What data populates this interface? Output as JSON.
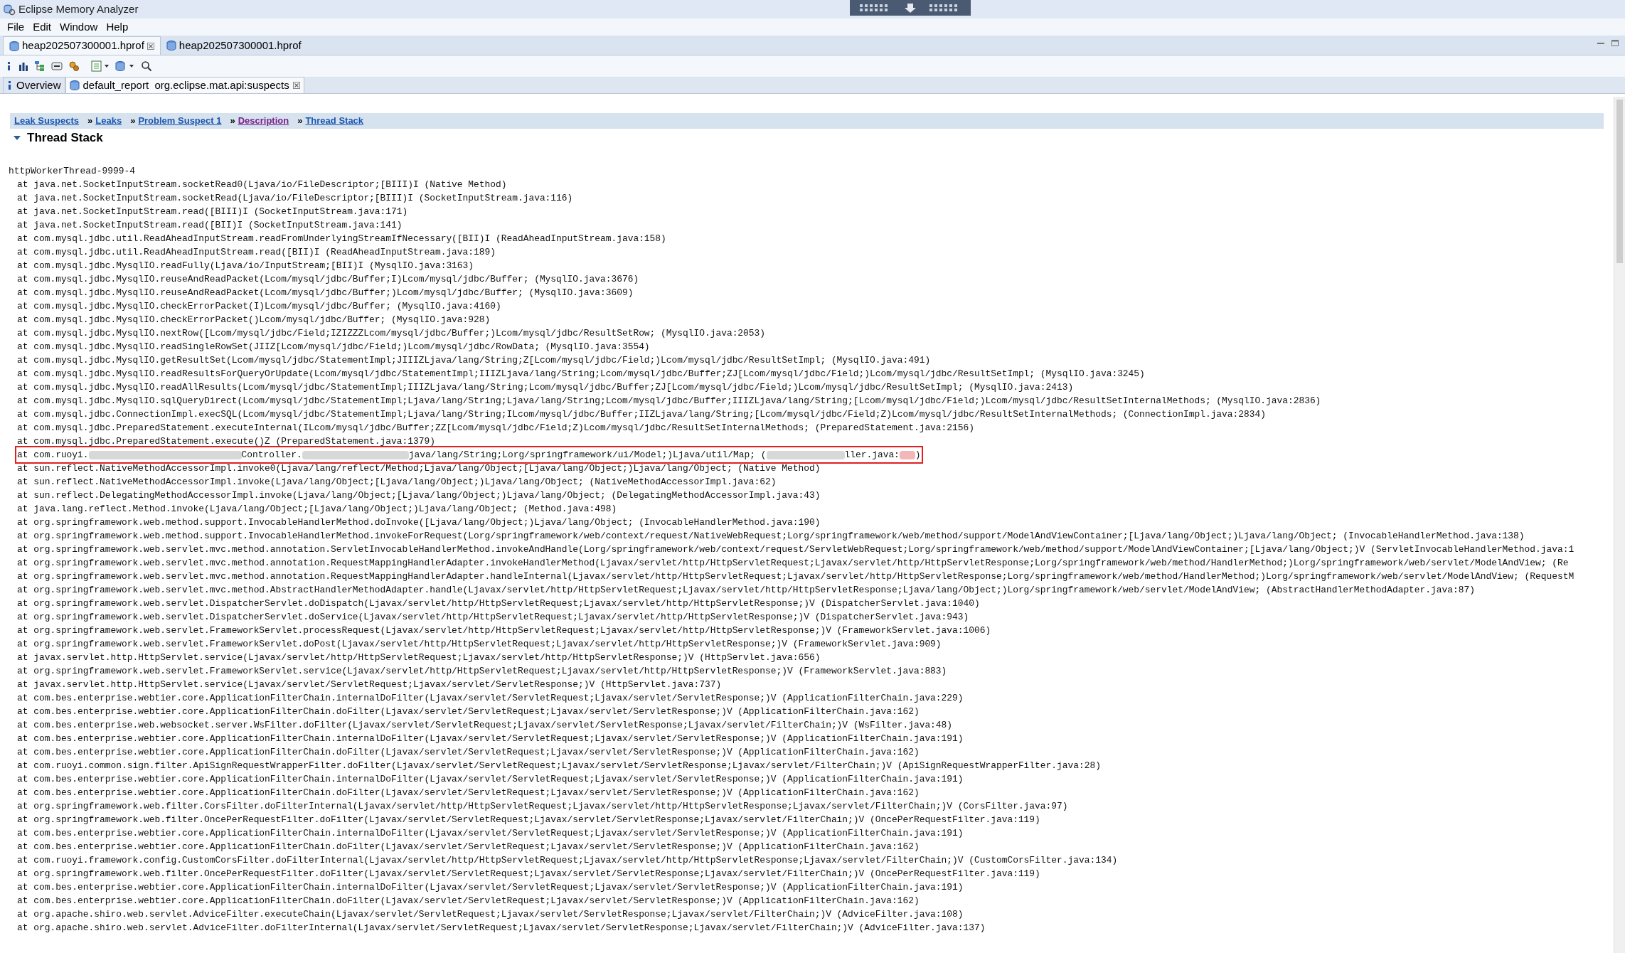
{
  "window": {
    "title": "Eclipse Memory Analyzer"
  },
  "menu": [
    "File",
    "Edit",
    "Window",
    "Help"
  ],
  "editor_tabs": [
    {
      "label": "heap202507300001.hprof",
      "selected": true,
      "closable": true
    },
    {
      "label": "heap202507300001.hprof",
      "selected": false,
      "closable": false
    }
  ],
  "inner_tabs": [
    {
      "label": "Overview",
      "selected": false,
      "closable": false,
      "kind": "info"
    },
    {
      "label": "default_report  org.eclipse.mat.api:suspects",
      "selected": true,
      "closable": true,
      "kind": "report"
    }
  ],
  "breadcrumbs": [
    {
      "label": "Leak Suspects",
      "visited": false
    },
    {
      "prefix": "»",
      "label": "Leaks",
      "visited": false
    },
    {
      "prefix": "»",
      "label": "Problem Suspect 1",
      "visited": false
    },
    {
      "prefix": "»",
      "label": "Description",
      "visited": true
    },
    {
      "prefix": "»",
      "label": "Thread Stack",
      "visited": false
    }
  ],
  "section": {
    "title": "Thread Stack",
    "expanded": true
  },
  "thread_name": "httpWorkerThread-9999-4",
  "frames": [
    {
      "kind": "plain",
      "highlighted": false,
      "text": "at java.net.SocketInputStream.socketRead0(Ljava/io/FileDescriptor;[BIII)I (Native Method)"
    },
    {
      "kind": "plain",
      "highlighted": false,
      "text": "at java.net.SocketInputStream.socketRead(Ljava/io/FileDescriptor;[BIII)I (SocketInputStream.java:116)"
    },
    {
      "kind": "plain",
      "highlighted": false,
      "text": "at java.net.SocketInputStream.read([BIII)I (SocketInputStream.java:171)"
    },
    {
      "kind": "plain",
      "highlighted": false,
      "text": "at java.net.SocketInputStream.read([BII)I (SocketInputStream.java:141)"
    },
    {
      "kind": "plain",
      "highlighted": false,
      "text": "at com.mysql.jdbc.util.ReadAheadInputStream.readFromUnderlyingStreamIfNecessary([BII)I (ReadAheadInputStream.java:158)"
    },
    {
      "kind": "plain",
      "highlighted": false,
      "text": "at com.mysql.jdbc.util.ReadAheadInputStream.read([BII)I (ReadAheadInputStream.java:189)"
    },
    {
      "kind": "plain",
      "highlighted": false,
      "text": "at com.mysql.jdbc.MysqlIO.readFully(Ljava/io/InputStream;[BII)I (MysqlIO.java:3163)"
    },
    {
      "kind": "plain",
      "highlighted": false,
      "text": "at com.mysql.jdbc.MysqlIO.reuseAndReadPacket(Lcom/mysql/jdbc/Buffer;I)Lcom/mysql/jdbc/Buffer; (MysqlIO.java:3676)"
    },
    {
      "kind": "plain",
      "highlighted": false,
      "text": "at com.mysql.jdbc.MysqlIO.reuseAndReadPacket(Lcom/mysql/jdbc/Buffer;)Lcom/mysql/jdbc/Buffer; (MysqlIO.java:3609)"
    },
    {
      "kind": "plain",
      "highlighted": false,
      "text": "at com.mysql.jdbc.MysqlIO.checkErrorPacket(I)Lcom/mysql/jdbc/Buffer; (MysqlIO.java:4160)"
    },
    {
      "kind": "plain",
      "highlighted": false,
      "text": "at com.mysql.jdbc.MysqlIO.checkErrorPacket()Lcom/mysql/jdbc/Buffer; (MysqlIO.java:928)"
    },
    {
      "kind": "plain",
      "highlighted": false,
      "text": "at com.mysql.jdbc.MysqlIO.nextRow([Lcom/mysql/jdbc/Field;IZIZZZLcom/mysql/jdbc/Buffer;)Lcom/mysql/jdbc/ResultSetRow; (MysqlIO.java:2053)"
    },
    {
      "kind": "plain",
      "highlighted": false,
      "text": "at com.mysql.jdbc.MysqlIO.readSingleRowSet(JIIZ[Lcom/mysql/jdbc/Field;)Lcom/mysql/jdbc/RowData; (MysqlIO.java:3554)"
    },
    {
      "kind": "plain",
      "highlighted": false,
      "text": "at com.mysql.jdbc.MysqlIO.getResultSet(Lcom/mysql/jdbc/StatementImpl;JIIIZLjava/lang/String;Z[Lcom/mysql/jdbc/Field;)Lcom/mysql/jdbc/ResultSetImpl; (MysqlIO.java:491)"
    },
    {
      "kind": "plain",
      "highlighted": false,
      "text": "at com.mysql.jdbc.MysqlIO.readResultsForQueryOrUpdate(Lcom/mysql/jdbc/StatementImpl;IIIZLjava/lang/String;Lcom/mysql/jdbc/Buffer;ZJ[Lcom/mysql/jdbc/Field;)Lcom/mysql/jdbc/ResultSetImpl; (MysqlIO.java:3245)"
    },
    {
      "kind": "plain",
      "highlighted": false,
      "text": "at com.mysql.jdbc.MysqlIO.readAllResults(Lcom/mysql/jdbc/StatementImpl;IIIZLjava/lang/String;Lcom/mysql/jdbc/Buffer;ZJ[Lcom/mysql/jdbc/Field;)Lcom/mysql/jdbc/ResultSetImpl; (MysqlIO.java:2413)"
    },
    {
      "kind": "plain",
      "highlighted": false,
      "text": "at com.mysql.jdbc.MysqlIO.sqlQueryDirect(Lcom/mysql/jdbc/StatementImpl;Ljava/lang/String;Ljava/lang/String;Lcom/mysql/jdbc/Buffer;IIIZLjava/lang/String;[Lcom/mysql/jdbc/Field;)Lcom/mysql/jdbc/ResultSetInternalMethods; (MysqlIO.java:2836)"
    },
    {
      "kind": "plain",
      "highlighted": false,
      "text": "at com.mysql.jdbc.ConnectionImpl.execSQL(Lcom/mysql/jdbc/StatementImpl;Ljava/lang/String;ILcom/mysql/jdbc/Buffer;IIZLjava/lang/String;[Lcom/mysql/jdbc/Field;Z)Lcom/mysql/jdbc/ResultSetInternalMethods; (ConnectionImpl.java:2834)"
    },
    {
      "kind": "plain",
      "highlighted": false,
      "text": "at com.mysql.jdbc.PreparedStatement.executeInternal(ILcom/mysql/jdbc/Buffer;ZZ[Lcom/mysql/jdbc/Field;Z)Lcom/mysql/jdbc/ResultSetInternalMethods; (PreparedStatement.java:2156)"
    },
    {
      "kind": "plain",
      "highlighted": false,
      "text": "at com.mysql.jdbc.PreparedStatement.execute()Z (PreparedStatement.java:1379)"
    },
    {
      "kind": "redacted",
      "highlighted": true,
      "segments": [
        "at com.ruoyi.",
        "Controller.",
        "java/lang/String;Lorg/springframework/ui/Model;)Ljava/util/Map; (",
        "ller.java:",
        ")"
      ]
    },
    {
      "kind": "plain",
      "highlighted": false,
      "text": "at sun.reflect.NativeMethodAccessorImpl.invoke0(Ljava/lang/reflect/Method;Ljava/lang/Object;[Ljava/lang/Object;)Ljava/lang/Object; (Native Method)"
    },
    {
      "kind": "plain",
      "highlighted": false,
      "text": "at sun.reflect.NativeMethodAccessorImpl.invoke(Ljava/lang/Object;[Ljava/lang/Object;)Ljava/lang/Object; (NativeMethodAccessorImpl.java:62)"
    },
    {
      "kind": "plain",
      "highlighted": false,
      "text": "at sun.reflect.DelegatingMethodAccessorImpl.invoke(Ljava/lang/Object;[Ljava/lang/Object;)Ljava/lang/Object; (DelegatingMethodAccessorImpl.java:43)"
    },
    {
      "kind": "plain",
      "highlighted": false,
      "text": "at java.lang.reflect.Method.invoke(Ljava/lang/Object;[Ljava/lang/Object;)Ljava/lang/Object; (Method.java:498)"
    },
    {
      "kind": "plain",
      "highlighted": false,
      "text": "at org.springframework.web.method.support.InvocableHandlerMethod.doInvoke([Ljava/lang/Object;)Ljava/lang/Object; (InvocableHandlerMethod.java:190)"
    },
    {
      "kind": "plain",
      "highlighted": false,
      "text": "at org.springframework.web.method.support.InvocableHandlerMethod.invokeForRequest(Lorg/springframework/web/context/request/NativeWebRequest;Lorg/springframework/web/method/support/ModelAndViewContainer;[Ljava/lang/Object;)Ljava/lang/Object; (InvocableHandlerMethod.java:138)"
    },
    {
      "kind": "plain",
      "highlighted": false,
      "text": "at org.springframework.web.servlet.mvc.method.annotation.ServletInvocableHandlerMethod.invokeAndHandle(Lorg/springframework/web/context/request/ServletWebRequest;Lorg/springframework/web/method/support/ModelAndViewContainer;[Ljava/lang/Object;)V (ServletInvocableHandlerMethod.java:1"
    },
    {
      "kind": "plain",
      "highlighted": false,
      "text": "at org.springframework.web.servlet.mvc.method.annotation.RequestMappingHandlerAdapter.invokeHandlerMethod(Ljavax/servlet/http/HttpServletRequest;Ljavax/servlet/http/HttpServletResponse;Lorg/springframework/web/method/HandlerMethod;)Lorg/springframework/web/servlet/ModelAndView; (Re"
    },
    {
      "kind": "plain",
      "highlighted": false,
      "text": "at org.springframework.web.servlet.mvc.method.annotation.RequestMappingHandlerAdapter.handleInternal(Ljavax/servlet/http/HttpServletRequest;Ljavax/servlet/http/HttpServletResponse;Lorg/springframework/web/method/HandlerMethod;)Lorg/springframework/web/servlet/ModelAndView; (RequestM"
    },
    {
      "kind": "plain",
      "highlighted": false,
      "text": "at org.springframework.web.servlet.mvc.method.AbstractHandlerMethodAdapter.handle(Ljavax/servlet/http/HttpServletRequest;Ljavax/servlet/http/HttpServletResponse;Ljava/lang/Object;)Lorg/springframework/web/servlet/ModelAndView; (AbstractHandlerMethodAdapter.java:87)"
    },
    {
      "kind": "plain",
      "highlighted": false,
      "text": "at org.springframework.web.servlet.DispatcherServlet.doDispatch(Ljavax/servlet/http/HttpServletRequest;Ljavax/servlet/http/HttpServletResponse;)V (DispatcherServlet.java:1040)"
    },
    {
      "kind": "plain",
      "highlighted": false,
      "text": "at org.springframework.web.servlet.DispatcherServlet.doService(Ljavax/servlet/http/HttpServletRequest;Ljavax/servlet/http/HttpServletResponse;)V (DispatcherServlet.java:943)"
    },
    {
      "kind": "plain",
      "highlighted": false,
      "text": "at org.springframework.web.servlet.FrameworkServlet.processRequest(Ljavax/servlet/http/HttpServletRequest;Ljavax/servlet/http/HttpServletResponse;)V (FrameworkServlet.java:1006)"
    },
    {
      "kind": "plain",
      "highlighted": false,
      "text": "at org.springframework.web.servlet.FrameworkServlet.doPost(Ljavax/servlet/http/HttpServletRequest;Ljavax/servlet/http/HttpServletResponse;)V (FrameworkServlet.java:909)"
    },
    {
      "kind": "plain",
      "highlighted": false,
      "text": "at javax.servlet.http.HttpServlet.service(Ljavax/servlet/http/HttpServletRequest;Ljavax/servlet/http/HttpServletResponse;)V (HttpServlet.java:656)"
    },
    {
      "kind": "plain",
      "highlighted": false,
      "text": "at org.springframework.web.servlet.FrameworkServlet.service(Ljavax/servlet/http/HttpServletRequest;Ljavax/servlet/http/HttpServletResponse;)V (FrameworkServlet.java:883)"
    },
    {
      "kind": "plain",
      "highlighted": false,
      "text": "at javax.servlet.http.HttpServlet.service(Ljavax/servlet/ServletRequest;Ljavax/servlet/ServletResponse;)V (HttpServlet.java:737)"
    },
    {
      "kind": "plain",
      "highlighted": false,
      "text": "at com.bes.enterprise.webtier.core.ApplicationFilterChain.internalDoFilter(Ljavax/servlet/ServletRequest;Ljavax/servlet/ServletResponse;)V (ApplicationFilterChain.java:229)"
    },
    {
      "kind": "plain",
      "highlighted": false,
      "text": "at com.bes.enterprise.webtier.core.ApplicationFilterChain.doFilter(Ljavax/servlet/ServletRequest;Ljavax/servlet/ServletResponse;)V (ApplicationFilterChain.java:162)"
    },
    {
      "kind": "plain",
      "highlighted": false,
      "text": "at com.bes.enterprise.web.websocket.server.WsFilter.doFilter(Ljavax/servlet/ServletRequest;Ljavax/servlet/ServletResponse;Ljavax/servlet/FilterChain;)V (WsFilter.java:48)"
    },
    {
      "kind": "plain",
      "highlighted": false,
      "text": "at com.bes.enterprise.webtier.core.ApplicationFilterChain.internalDoFilter(Ljavax/servlet/ServletRequest;Ljavax/servlet/ServletResponse;)V (ApplicationFilterChain.java:191)"
    },
    {
      "kind": "plain",
      "highlighted": false,
      "text": "at com.bes.enterprise.webtier.core.ApplicationFilterChain.doFilter(Ljavax/servlet/ServletRequest;Ljavax/servlet/ServletResponse;)V (ApplicationFilterChain.java:162)"
    },
    {
      "kind": "plain",
      "highlighted": false,
      "text": "at com.ruoyi.common.sign.filter.ApiSignRequestWrapperFilter.doFilter(Ljavax/servlet/ServletRequest;Ljavax/servlet/ServletResponse;Ljavax/servlet/FilterChain;)V (ApiSignRequestWrapperFilter.java:28)"
    },
    {
      "kind": "plain",
      "highlighted": false,
      "text": "at com.bes.enterprise.webtier.core.ApplicationFilterChain.internalDoFilter(Ljavax/servlet/ServletRequest;Ljavax/servlet/ServletResponse;)V (ApplicationFilterChain.java:191)"
    },
    {
      "kind": "plain",
      "highlighted": false,
      "text": "at com.bes.enterprise.webtier.core.ApplicationFilterChain.doFilter(Ljavax/servlet/ServletRequest;Ljavax/servlet/ServletResponse;)V (ApplicationFilterChain.java:162)"
    },
    {
      "kind": "plain",
      "highlighted": false,
      "text": "at org.springframework.web.filter.CorsFilter.doFilterInternal(Ljavax/servlet/http/HttpServletRequest;Ljavax/servlet/http/HttpServletResponse;Ljavax/servlet/FilterChain;)V (CorsFilter.java:97)"
    },
    {
      "kind": "plain",
      "highlighted": false,
      "text": "at org.springframework.web.filter.OncePerRequestFilter.doFilter(Ljavax/servlet/ServletRequest;Ljavax/servlet/ServletResponse;Ljavax/servlet/FilterChain;)V (OncePerRequestFilter.java:119)"
    },
    {
      "kind": "plain",
      "highlighted": false,
      "text": "at com.bes.enterprise.webtier.core.ApplicationFilterChain.internalDoFilter(Ljavax/servlet/ServletRequest;Ljavax/servlet/ServletResponse;)V (ApplicationFilterChain.java:191)"
    },
    {
      "kind": "plain",
      "highlighted": false,
      "text": "at com.bes.enterprise.webtier.core.ApplicationFilterChain.doFilter(Ljavax/servlet/ServletRequest;Ljavax/servlet/ServletResponse;)V (ApplicationFilterChain.java:162)"
    },
    {
      "kind": "plain",
      "highlighted": false,
      "text": "at com.ruoyi.framework.config.CustomCorsFilter.doFilterInternal(Ljavax/servlet/http/HttpServletRequest;Ljavax/servlet/http/HttpServletResponse;Ljavax/servlet/FilterChain;)V (CustomCorsFilter.java:134)"
    },
    {
      "kind": "plain",
      "highlighted": false,
      "text": "at org.springframework.web.filter.OncePerRequestFilter.doFilter(Ljavax/servlet/ServletRequest;Ljavax/servlet/ServletResponse;Ljavax/servlet/FilterChain;)V (OncePerRequestFilter.java:119)"
    },
    {
      "kind": "plain",
      "highlighted": false,
      "text": "at com.bes.enterprise.webtier.core.ApplicationFilterChain.internalDoFilter(Ljavax/servlet/ServletRequest;Ljavax/servlet/ServletResponse;)V (ApplicationFilterChain.java:191)"
    },
    {
      "kind": "plain",
      "highlighted": false,
      "text": "at com.bes.enterprise.webtier.core.ApplicationFilterChain.doFilter(Ljavax/servlet/ServletRequest;Ljavax/servlet/ServletResponse;)V (ApplicationFilterChain.java:162)"
    },
    {
      "kind": "plain",
      "highlighted": false,
      "text": "at org.apache.shiro.web.servlet.AdviceFilter.executeChain(Ljavax/servlet/ServletRequest;Ljavax/servlet/ServletResponse;Ljavax/servlet/FilterChain;)V (AdviceFilter.java:108)"
    },
    {
      "kind": "plain",
      "highlighted": false,
      "text": "at org.apache.shiro.web.servlet.AdviceFilter.doFilterInternal(Ljavax/servlet/ServletRequest;Ljavax/servlet/ServletResponse;Ljavax/servlet/FilterChain;)V (AdviceFilter.java:137)"
    }
  ]
}
